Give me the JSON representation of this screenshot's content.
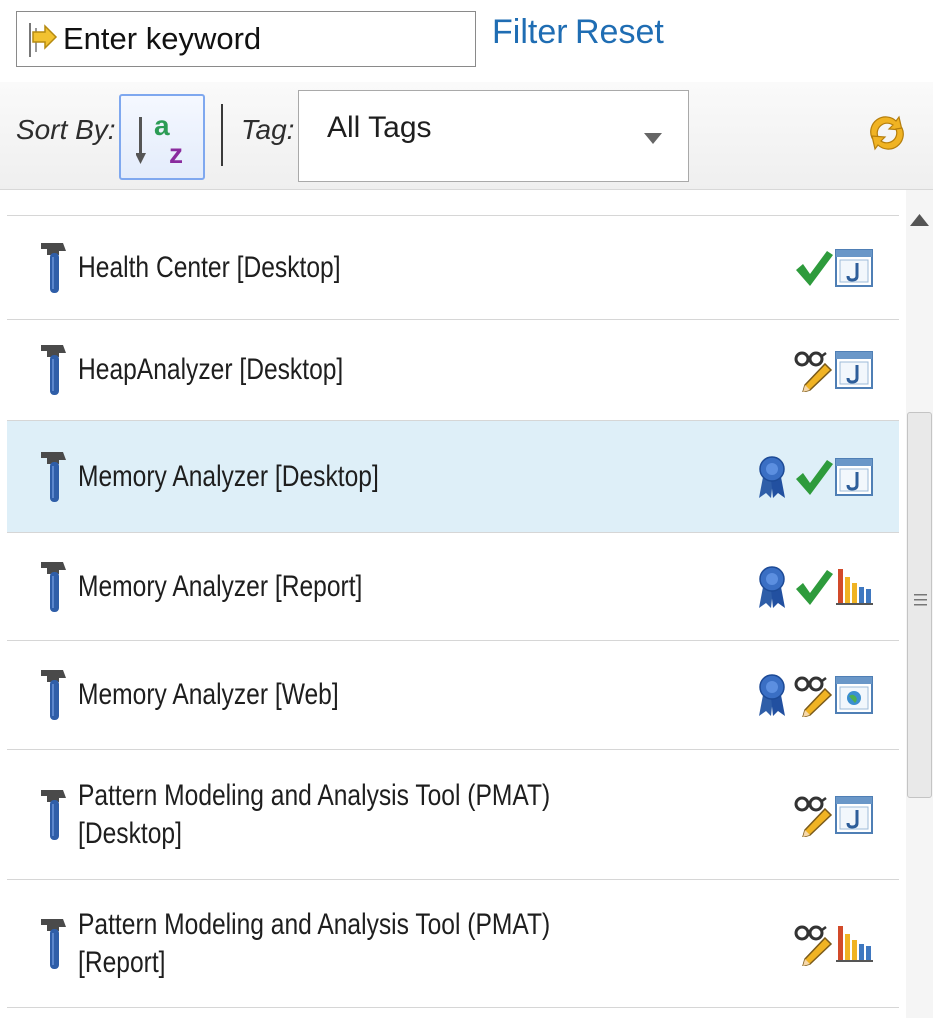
{
  "search": {
    "placeholder": "Enter keyword",
    "filter_label": "Filter",
    "reset_label": "Reset"
  },
  "toolbar": {
    "sort_label": "Sort By:",
    "sort_icon": "sort-alpha-icon",
    "tag_label": "Tag:",
    "tag_selected": "All Tags",
    "refresh_icon": "refresh-icon"
  },
  "colors": {
    "link": "#1f6db3",
    "selected_row": "#deeff8",
    "check": "#2e9b3c",
    "tool_blue": "#2f5ea8"
  },
  "tools": [
    {
      "lines": [
        "Health Center [Desktop]"
      ],
      "selected": false,
      "icons": [
        "check",
        "java-app"
      ]
    },
    {
      "lines": [
        "HeapAnalyzer [Desktop]"
      ],
      "selected": false,
      "icons": [
        "glasses-pencil",
        "java-app"
      ]
    },
    {
      "lines": [
        "Memory Analyzer [Desktop]"
      ],
      "selected": true,
      "icons": [
        "ribbon",
        "check",
        "java-app"
      ]
    },
    {
      "lines": [
        "Memory Analyzer [Report]"
      ],
      "selected": false,
      "icons": [
        "ribbon",
        "check",
        "bar-chart"
      ]
    },
    {
      "lines": [
        "Memory Analyzer [Web]"
      ],
      "selected": false,
      "icons": [
        "ribbon",
        "glasses-pencil",
        "web-app"
      ]
    },
    {
      "lines": [
        "Pattern Modeling and Analysis Tool (PMAT)",
        "[Desktop]"
      ],
      "selected": false,
      "icons": [
        "glasses-pencil",
        "java-app"
      ]
    },
    {
      "lines": [
        "Pattern Modeling and Analysis Tool (PMAT)",
        "[Report]"
      ],
      "selected": false,
      "icons": [
        "glasses-pencil",
        "bar-chart"
      ]
    }
  ]
}
